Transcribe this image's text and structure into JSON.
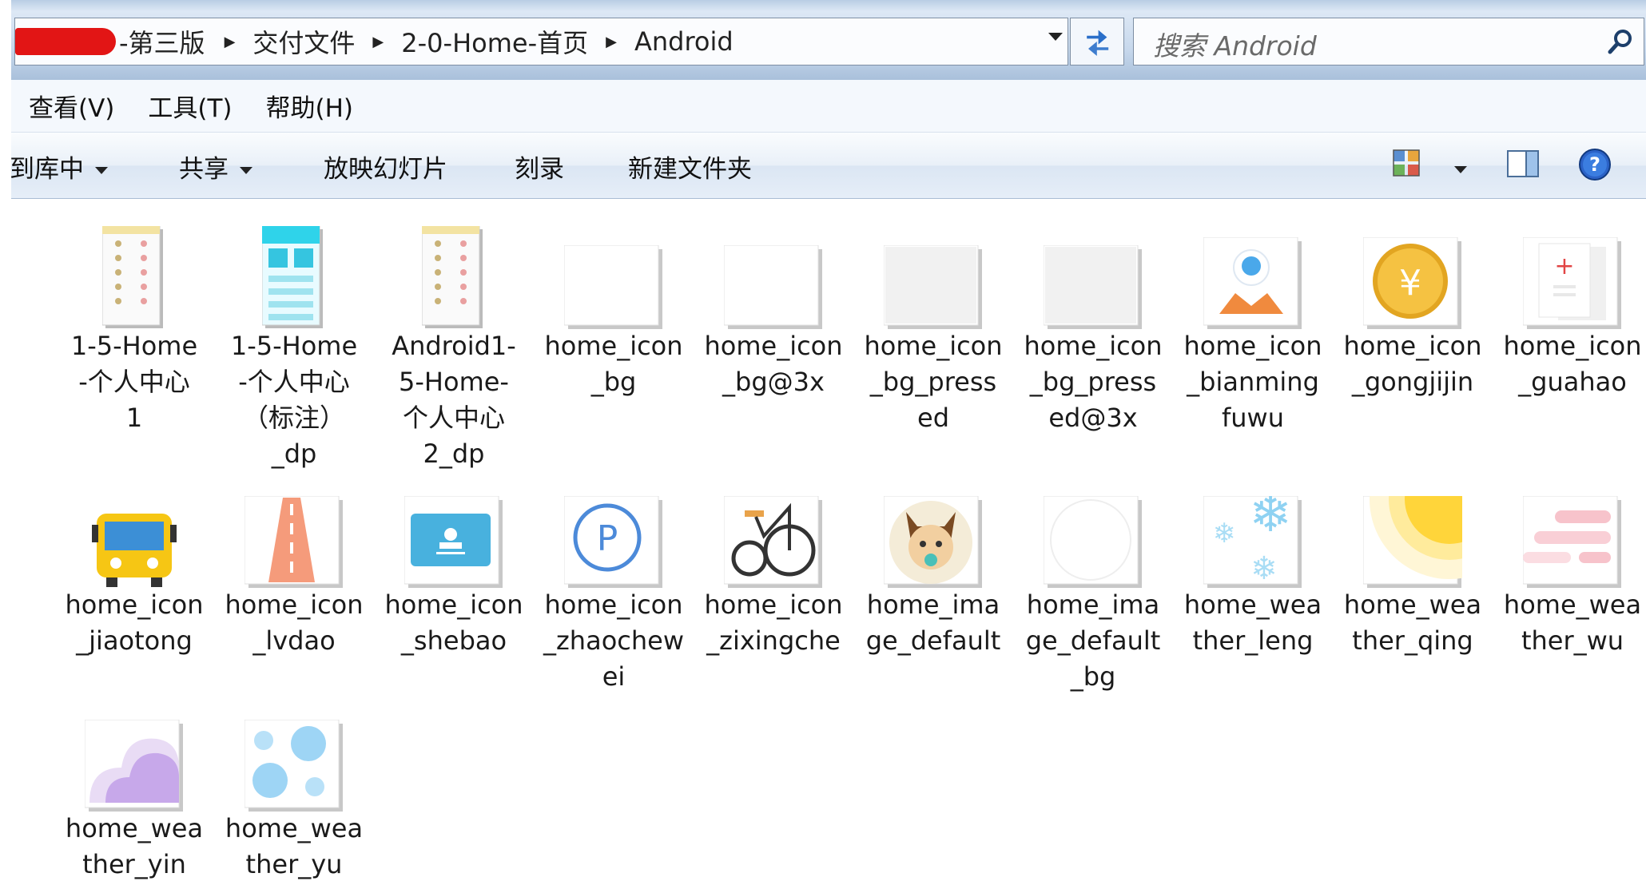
{
  "address": {
    "crumbs": [
      "-第三版",
      "交付文件",
      "2-0-Home-首页",
      "Android"
    ]
  },
  "search": {
    "placeholder": "搜索 Android"
  },
  "menu": [
    "查看(V)",
    "工具(T)",
    "帮助(H)"
  ],
  "toolbar": {
    "include_in_library": "到库中",
    "share": "共享",
    "slideshow": "放映幻灯片",
    "burn": "刻录",
    "new_folder": "新建文件夹"
  },
  "files": [
    {
      "name": "1-5-Home-个人中心1",
      "lines": [
        "1-5-Home",
        "-个人中心",
        "1"
      ],
      "icon": "phone-screenshot"
    },
    {
      "name": "1-5-Home-个人中心（标注）_dp",
      "lines": [
        "1-5-Home",
        "-个人中心",
        "（标注）",
        "_dp"
      ],
      "icon": "phone-screenshot-annotated"
    },
    {
      "name": "Android1-5-Home-个人中心2_dp",
      "lines": [
        "Android1-",
        "5-Home-",
        "个人中心",
        "2_dp"
      ],
      "icon": "phone-screenshot"
    },
    {
      "name": "home_icon_bg",
      "lines": [
        "home_icon",
        "_bg"
      ],
      "icon": "blank-square"
    },
    {
      "name": "home_icon_bg@3x",
      "lines": [
        "home_icon",
        "_bg@3x"
      ],
      "icon": "blank-square"
    },
    {
      "name": "home_icon_bg_pressed",
      "lines": [
        "home_icon",
        "_bg_press",
        "ed"
      ],
      "icon": "grey-square"
    },
    {
      "name": "home_icon_bg_pressed@3x",
      "lines": [
        "home_icon",
        "_bg_press",
        "ed@3x"
      ],
      "icon": "grey-square"
    },
    {
      "name": "home_icon_bianmingfuwu",
      "lines": [
        "home_icon",
        "_bianming",
        "fuwu"
      ],
      "icon": "map-pin-icon"
    },
    {
      "name": "home_icon_gongjijin",
      "lines": [
        "home_icon",
        "_gongjijin"
      ],
      "icon": "yen-coin-icon"
    },
    {
      "name": "home_icon_guahao",
      "lines": [
        "home_icon",
        "_guahao"
      ],
      "icon": "medical-card-icon"
    },
    {
      "name": "home_icon_jiaotong",
      "lines": [
        "home_icon",
        "_jiaotong"
      ],
      "icon": "bus-icon"
    },
    {
      "name": "home_icon_lvdao",
      "lines": [
        "home_icon",
        "_lvdao"
      ],
      "icon": "road-icon"
    },
    {
      "name": "home_icon_shebao",
      "lines": [
        "home_icon",
        "_shebao"
      ],
      "icon": "id-card-icon"
    },
    {
      "name": "home_icon_zhaochewei",
      "lines": [
        "home_icon",
        "_zhaochew",
        "ei"
      ],
      "icon": "parking-icon"
    },
    {
      "name": "home_icon_zixingche",
      "lines": [
        "home_icon",
        "_zixingche"
      ],
      "icon": "bicycle-icon"
    },
    {
      "name": "home_image_default",
      "lines": [
        "home_ima",
        "ge_default"
      ],
      "icon": "avatar-icon"
    },
    {
      "name": "home_image_default_bg",
      "lines": [
        "home_ima",
        "ge_default",
        "_bg"
      ],
      "icon": "white-circle-icon"
    },
    {
      "name": "home_weather_leng",
      "lines": [
        "home_wea",
        "ther_leng"
      ],
      "icon": "snowflake-icon"
    },
    {
      "name": "home_weather_qing",
      "lines": [
        "home_wea",
        "ther_qing"
      ],
      "icon": "sun-icon"
    },
    {
      "name": "home_weather_wu",
      "lines": [
        "home_wea",
        "ther_wu"
      ],
      "icon": "fog-icon"
    },
    {
      "name": "home_weather_yin",
      "lines": [
        "home_wea",
        "ther_yin"
      ],
      "icon": "cloud-icon"
    },
    {
      "name": "home_weather_yu",
      "lines": [
        "home_wea",
        "ther_yu"
      ],
      "icon": "rain-icon"
    }
  ],
  "colors": {
    "accent": "#3399ff",
    "toolbar_bg": "#dbe6f3"
  }
}
